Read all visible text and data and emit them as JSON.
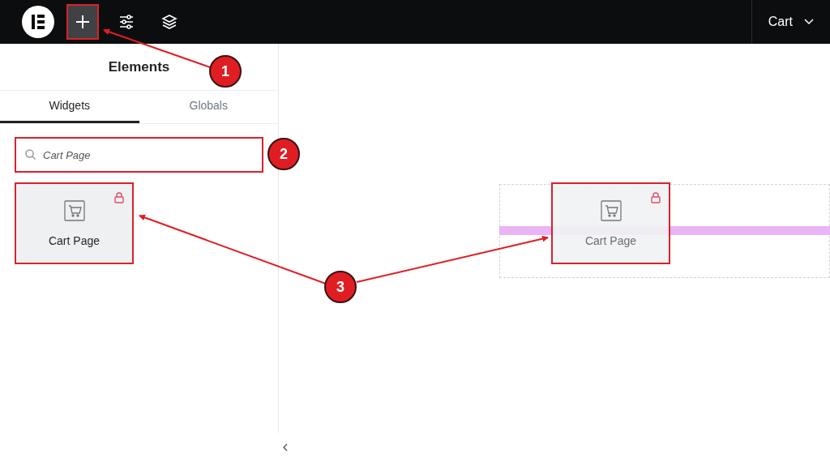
{
  "top_bar": {
    "page_selector": "Cart"
  },
  "panel": {
    "title": "Elements",
    "tabs": [
      {
        "label": "Widgets",
        "selected": true
      },
      {
        "label": "Globals",
        "selected": false
      }
    ],
    "search": {
      "value": "Cart Page"
    },
    "widgets": [
      {
        "label": "Cart Page",
        "locked": true
      }
    ]
  },
  "canvas": {
    "dragged_widget": {
      "label": "Cart Page",
      "locked": true
    }
  },
  "annotations": [
    {
      "number": "1"
    },
    {
      "number": "2"
    },
    {
      "number": "3"
    }
  ]
}
